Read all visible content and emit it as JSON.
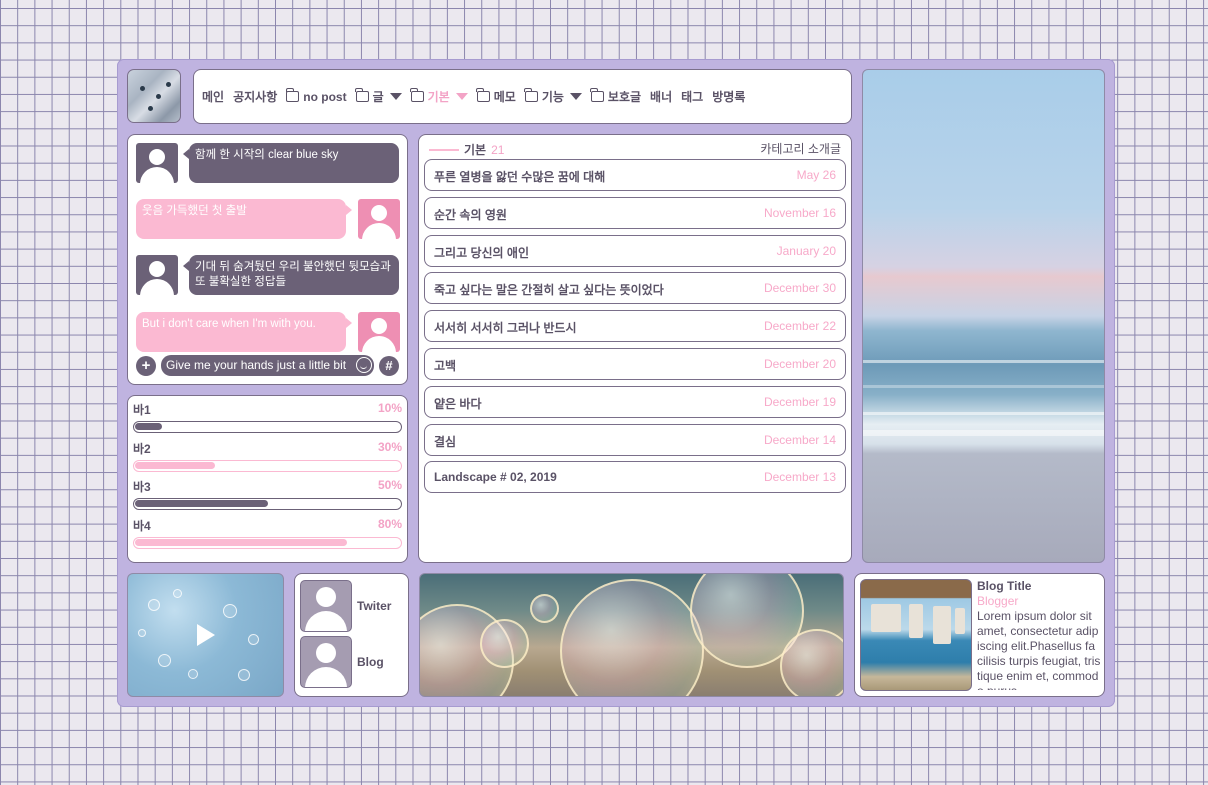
{
  "nav": {
    "items": [
      {
        "label": "메인",
        "folder": false,
        "caret": false,
        "active": false
      },
      {
        "label": "공지사항",
        "folder": false,
        "caret": false,
        "active": false
      },
      {
        "label": "no post",
        "folder": true,
        "caret": false,
        "active": false
      },
      {
        "label": "글",
        "folder": true,
        "caret": true,
        "active": false
      },
      {
        "label": "기본",
        "folder": true,
        "caret": true,
        "active": true
      },
      {
        "label": "메모",
        "folder": true,
        "caret": false,
        "active": false
      },
      {
        "label": "기능",
        "folder": true,
        "caret": true,
        "active": false
      },
      {
        "label": "보호글",
        "folder": true,
        "caret": false,
        "active": false
      },
      {
        "label": "배너",
        "folder": false,
        "caret": false,
        "active": false
      },
      {
        "label": "태그",
        "folder": false,
        "caret": false,
        "active": false
      },
      {
        "label": "방명록",
        "folder": false,
        "caret": false,
        "active": false
      }
    ]
  },
  "chat": {
    "messages": [
      {
        "side": "left",
        "text": "함께 한 시작의 clear blue sky"
      },
      {
        "side": "right",
        "text": "웃음 가득했던 첫 출발"
      },
      {
        "side": "left",
        "text": "기대 뒤 숨겨뒀던 우리 불안했던 뒷모습과 또 불확실한 정답들"
      },
      {
        "side": "right",
        "text": "But i don't care when I'm with you."
      }
    ],
    "add_label": "+",
    "hash_label": "#",
    "input_value": "Give me your hands just a little bit"
  },
  "bars": [
    {
      "label": "바1",
      "percent_text": "10%",
      "value": 10,
      "style": "dark"
    },
    {
      "label": "바2",
      "percent_text": "30%",
      "value": 30,
      "style": "pink"
    },
    {
      "label": "바3",
      "percent_text": "50%",
      "value": 50,
      "style": "dark"
    },
    {
      "label": "바4",
      "percent_text": "80%",
      "value": 80,
      "style": "pink"
    }
  ],
  "posts": {
    "category": "기본",
    "count": "21",
    "intro_link": "카테고리 소개글",
    "rows": [
      {
        "title": "푸른 열병을 앓던 수많은 꿈에 대해",
        "date": "May 26"
      },
      {
        "title": "순간 속의 영원",
        "date": "November 16"
      },
      {
        "title": "그리고 당신의 애인",
        "date": "January 20"
      },
      {
        "title": "죽고 싶다는 말은 간절히 살고 싶다는 뜻이었다",
        "date": "December 30"
      },
      {
        "title": "서서히 서서히 그러나 반드시",
        "date": "December 22"
      },
      {
        "title": "고백",
        "date": "December 20"
      },
      {
        "title": "얕은 바다",
        "date": "December 19"
      },
      {
        "title": "결심",
        "date": "December 14"
      },
      {
        "title": "Landscape # 02, 2019",
        "date": "December 13"
      }
    ]
  },
  "links": [
    {
      "label": "Twiter"
    },
    {
      "label": "Blog"
    }
  ],
  "profile": {
    "title": "Blog Title",
    "subtitle": "Blogger",
    "text": "Lorem ipsum dolor sit amet, consectetur adipiscing elit.Phasellus facilisis turpis feugiat, tristique enim et, commodo purus."
  },
  "colors": {
    "frame": "#bfb3e0",
    "dark": "#6b6177",
    "pink": "#fbb9d2",
    "accent_text": "#f3a3c6",
    "text": "#5a5266"
  },
  "icons": {
    "folder": "folder-icon",
    "caret": "caret-down-icon",
    "add": "plus-icon",
    "emoji": "smile-icon",
    "hash": "hash-icon",
    "play": "play-icon",
    "avatar": "user-avatar-icon"
  }
}
